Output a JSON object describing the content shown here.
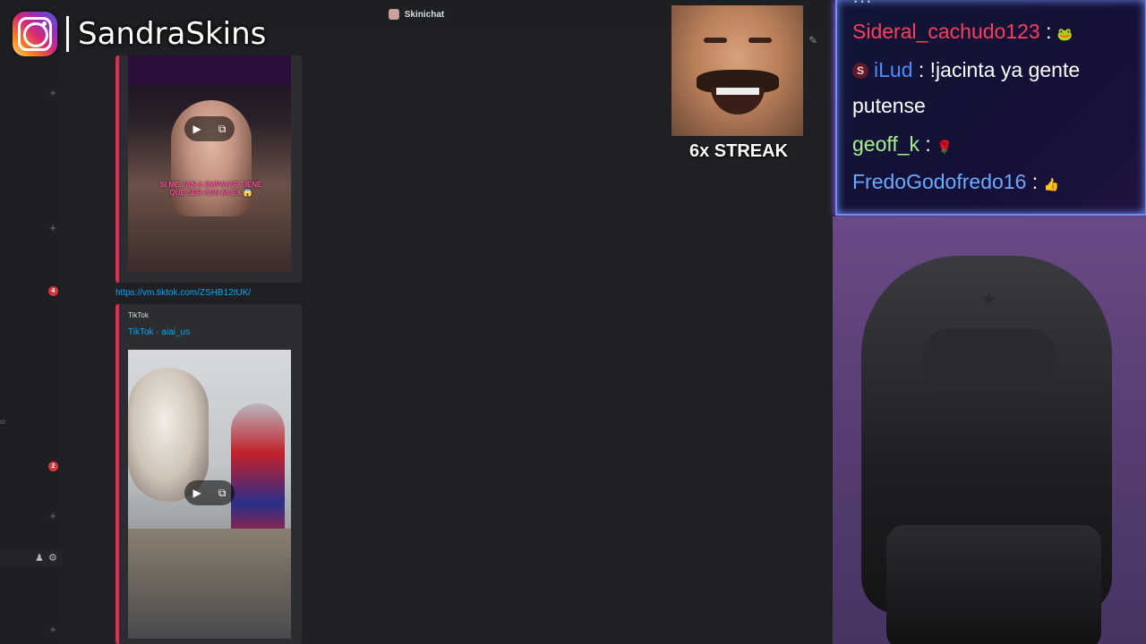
{
  "window": {
    "title": "Skinichat"
  },
  "watermark": {
    "name": "SandraSkins",
    "icon": "instagram-icon"
  },
  "sidebar": {
    "badges": [
      "4",
      "2"
    ],
    "edge_text": "os"
  },
  "messages": {
    "first_embed": {
      "video_caption": "SI ME VAN A EMPAYAR TIENE QUE SER CON MI EX 😱"
    },
    "link": "https://vm.tiktok.com/ZSHB12tUK/",
    "second_embed": {
      "provider": "TikTok",
      "title": "TikTok · aiai_us"
    }
  },
  "streak": {
    "label": "6x STREAK"
  },
  "chat_overlay": {
    "colors": {
      "border": "#6f8df0",
      "glow": "#a56ff0"
    },
    "lines": [
      {
        "user": "Sideral_cachudo123",
        "sep": " : ",
        "text": "🐸",
        "color": "#ff3f5a"
      },
      {
        "user": "iLud",
        "sep": " : ",
        "text": "!jacinta ya gente",
        "color": "#4d8cff",
        "badge": "S"
      },
      {
        "user": "",
        "sep": "",
        "text": "putense",
        "color": "#ffffff"
      },
      {
        "user": "geoff_k",
        "sep": " : ",
        "text": "🌹",
        "color": "#a9f08a"
      },
      {
        "user": "FredoGodofredo16",
        "sep": " : ",
        "text": "👍",
        "color": "#6aaaff"
      }
    ]
  }
}
